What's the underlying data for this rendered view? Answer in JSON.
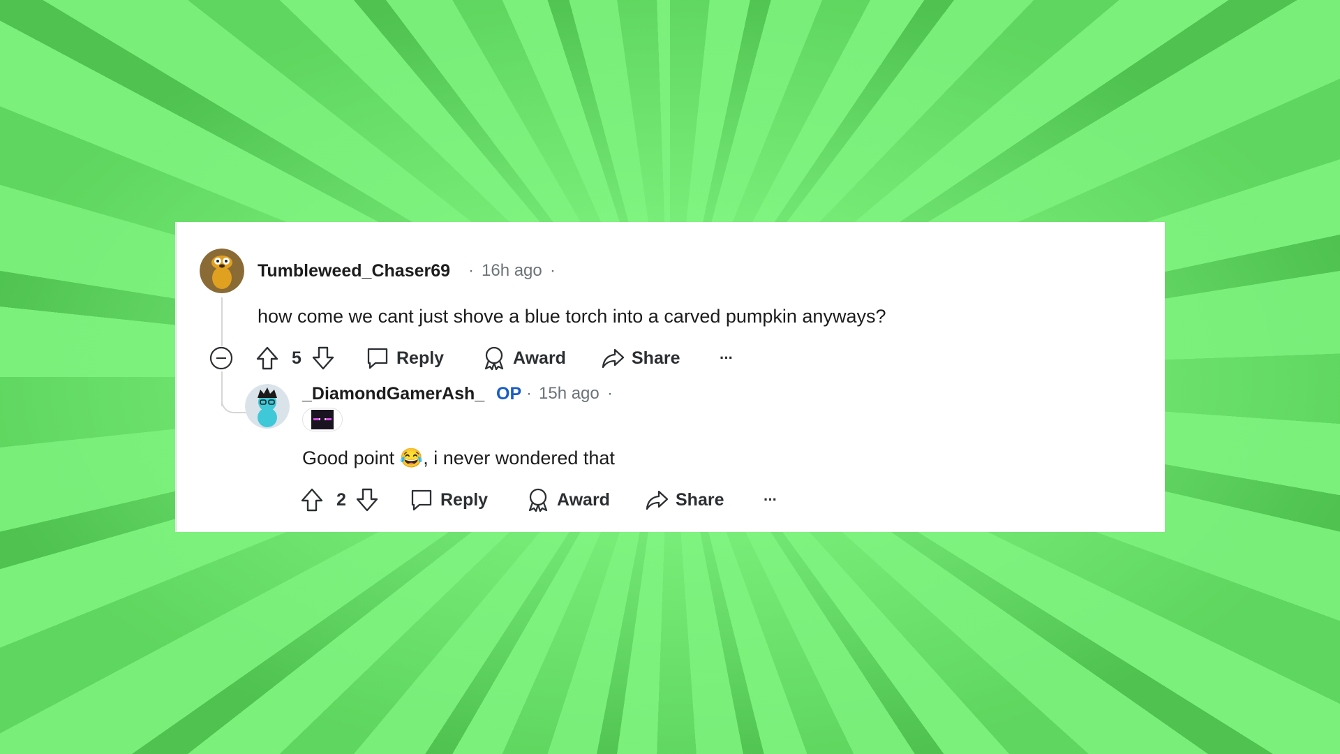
{
  "comment": {
    "username": "Tumbleweed_Chaser69",
    "time": "16h ago",
    "text": "how come we cant just shove a blue torch into a carved pumpkin anyways?",
    "votes": "5",
    "actions": {
      "reply": "Reply",
      "award": "Award",
      "share": "Share",
      "more": "···"
    }
  },
  "reply": {
    "username": "_DiamondGamerAsh_",
    "op_badge": "OP",
    "time": "15h ago",
    "text_before": "Good point",
    "emoji": "😂",
    "text_after": ", i never wondered that",
    "votes": "2",
    "actions": {
      "reply": "Reply",
      "award": "Award",
      "share": "Share",
      "more": "···"
    }
  },
  "separator": "·",
  "colors": {
    "op": "#1a5cc7",
    "meta": "#6b7378",
    "text": "#1c1c1c",
    "background": "#7bf07b"
  }
}
